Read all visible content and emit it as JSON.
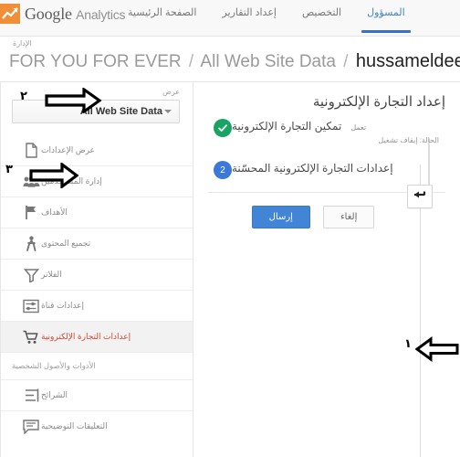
{
  "brand": {
    "name_bold": "Google",
    "name_light": "Analytics",
    "logo_icon": "analytics-chart-icon",
    "logo_color": "#f18f38"
  },
  "nav": {
    "tabs": [
      {
        "label": "الصفحة الرئيسية",
        "active": false
      },
      {
        "label": "إعداد التقارير",
        "active": false
      },
      {
        "label": "التخصيص",
        "active": false
      },
      {
        "label": "المسؤول",
        "active": true
      }
    ],
    "active_color": "#3a71c8"
  },
  "breadcrumb": {
    "admin_label": "الإدارة",
    "account": "FOR YOU FOR EVER",
    "property": "All Web Site Data",
    "view": "hussameldeen",
    "separator": "/"
  },
  "main": {
    "title": "إعداد التجارة الإلكترونية",
    "steps": [
      {
        "badge": "check",
        "badge_color": "#19a463",
        "title": "تمكين التجارة الإلكترونية",
        "flag": "تعمل",
        "status": "الحالة: إيقاف تشغيل"
      },
      {
        "badge": "2",
        "badge_color": "#3c78d8",
        "title": "إعدادات التجارة الإلكترونية المحسّنة",
        "flag": "",
        "status": ""
      }
    ],
    "buttons": {
      "submit": "إرسال",
      "cancel": "إلغاء",
      "submit_color": "#4285d6"
    }
  },
  "sidebar": {
    "view_label": "عرض",
    "view_selected": "All Web Site Data",
    "items": [
      {
        "label": "عرض الإعدادات",
        "icon": "document-icon",
        "active": false
      },
      {
        "label": "إدارة المستخدمين",
        "icon": "users-icon",
        "active": false
      },
      {
        "label": "الأهداف",
        "icon": "flag-icon",
        "active": false
      },
      {
        "label": "تجميع المحتوى",
        "icon": "walking-person-icon",
        "active": false
      },
      {
        "label": "الفلاتر",
        "icon": "funnel-icon",
        "active": false
      },
      {
        "label": "إعدادات قناة",
        "icon": "channel-settings-icon",
        "active": false
      },
      {
        "label": "إعدادات التجارة الإلكترونية",
        "icon": "shopping-cart-icon",
        "active": true
      }
    ],
    "section_header": "الأدوات والأصول الشخصية",
    "tools": [
      {
        "label": "الشرائح",
        "icon": "segments-icon"
      },
      {
        "label": "التعليقات التوضيحية",
        "icon": "annotation-icon"
      }
    ],
    "active_color": "#d14836",
    "back_button_icon": "back-arrow-icon"
  },
  "annotations": [
    {
      "number": "١",
      "points": "left"
    },
    {
      "number": "٢",
      "points": "right"
    },
    {
      "number": "٣",
      "points": "right"
    }
  ]
}
